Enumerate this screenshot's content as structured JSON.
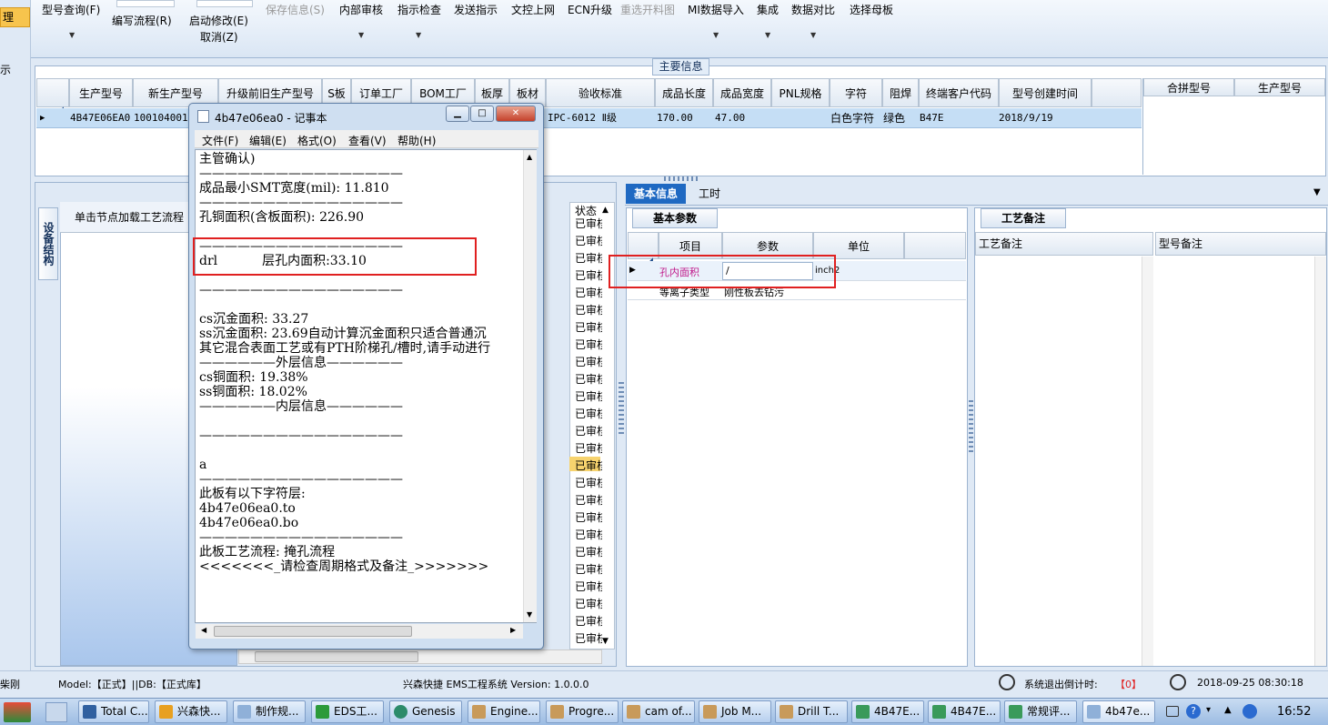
{
  "left_nav": {
    "selected": "理",
    "item2": "示"
  },
  "ribbon": {
    "items": [
      "型号查询(F)",
      "编写流程(R)",
      "启动修改(E)",
      "取消(Z)",
      "保存信息(S)",
      "内部审核",
      "指示检查",
      "发送指示",
      "文控上网",
      "ECN升级",
      "重选开料图",
      "MI数据导入",
      "集成",
      "数据对比",
      "选择母板"
    ]
  },
  "main_info": {
    "title": "主要信息",
    "columns": [
      "生产型号",
      "新生产型号",
      "升级前旧生产型号",
      "S板",
      "订单工厂",
      "BOM工厂",
      "板厚",
      "板材",
      "验收标准",
      "成品长度",
      "成品宽度",
      "PNL规格",
      "字符",
      "阻焊",
      "终端客户代码",
      "型号创建时间"
    ],
    "row": {
      "prod_no": "4B47E06EA0",
      "new_prod_no": "1001040012",
      "standard": "IPC-6012 Ⅱ级",
      "length": "170.00",
      "width": "47.00",
      "char": "白色字符",
      "mask": "绿色",
      "customer": "B47E",
      "created": "2018/9/19"
    },
    "merge_columns": [
      "合拼型号",
      "生产型号"
    ]
  },
  "left_panel": {
    "vtab": "设备结构",
    "flow_header": "单击节点加载工艺流程",
    "status_header": "状态",
    "status_value": "已审核"
  },
  "right_panel": {
    "tabs": [
      "基本信息",
      "工时"
    ],
    "param_tab": "基本参数",
    "param_columns": [
      "项目",
      "参数",
      "单位"
    ],
    "rows": [
      {
        "item": "孔内面积",
        "param": "/",
        "unit": "inch2"
      },
      {
        "item": "等离子类型",
        "param": "刚性板去钻污",
        "unit": ""
      }
    ],
    "remark_tab": "工艺备注",
    "remark_columns": [
      "工艺备注",
      "型号备注"
    ]
  },
  "notepad": {
    "title": "4b47e06ea0 - 记事本",
    "menu": [
      "文件(F)",
      "编辑(E)",
      "格式(O)",
      "查看(V)",
      "帮助(H)"
    ],
    "lines": [
      "主管确认)",
      "————————————————",
      "成品最小SMT宽度(mil): 11.810",
      "————————————————",
      "孔铜面积(含板面积): 226.90",
      "",
      "————————————————",
      "drl           层孔内面积:33.10",
      "",
      "————————————————",
      "",
      "cs沉金面积: 33.27",
      "ss沉金面积: 23.69自动计算沉金面积只适合普通沉",
      "其它混合表面工艺或有PTH阶梯孔/槽时,请手动进行",
      "——————外层信息——————",
      "cs铜面积: 19.38%",
      "ss铜面积: 18.02%",
      "——————内层信息——————",
      "",
      "————————————————",
      "",
      "a",
      "————————————————",
      "此板有以下字符层:",
      "4b47e06ea0.to",
      "4b47e06ea0.bo",
      "————————————————",
      "此板工艺流程: 掩孔流程",
      "<<<<<<<_请检查周期格式及备注_>>>>>>>"
    ]
  },
  "statusbar": {
    "left": "柴刚",
    "model": "Model:【正式】||DB:【正式库】",
    "system": "兴森快捷 EMS工程系统 Version: 1.0.0.0",
    "countdown_label": "系统退出倒计时:",
    "countdown_value": "【0】",
    "datetime": "2018-09-25 08:30:18"
  },
  "taskbar": {
    "items": [
      "Total C...",
      "兴森快...",
      "制作规...",
      "EDS工...",
      "Genesis",
      "Engine...",
      "Progre...",
      "cam of...",
      "Job M...",
      "Drill T...",
      "4B47E...",
      "4B47E...",
      "常规评...",
      "4b47e..."
    ],
    "time": "16:52"
  },
  "colors": {
    "accent": "#1f69c2",
    "highlight": "#e02020",
    "selected_row": "#c5def5",
    "magenta_text": "#c0188a"
  }
}
